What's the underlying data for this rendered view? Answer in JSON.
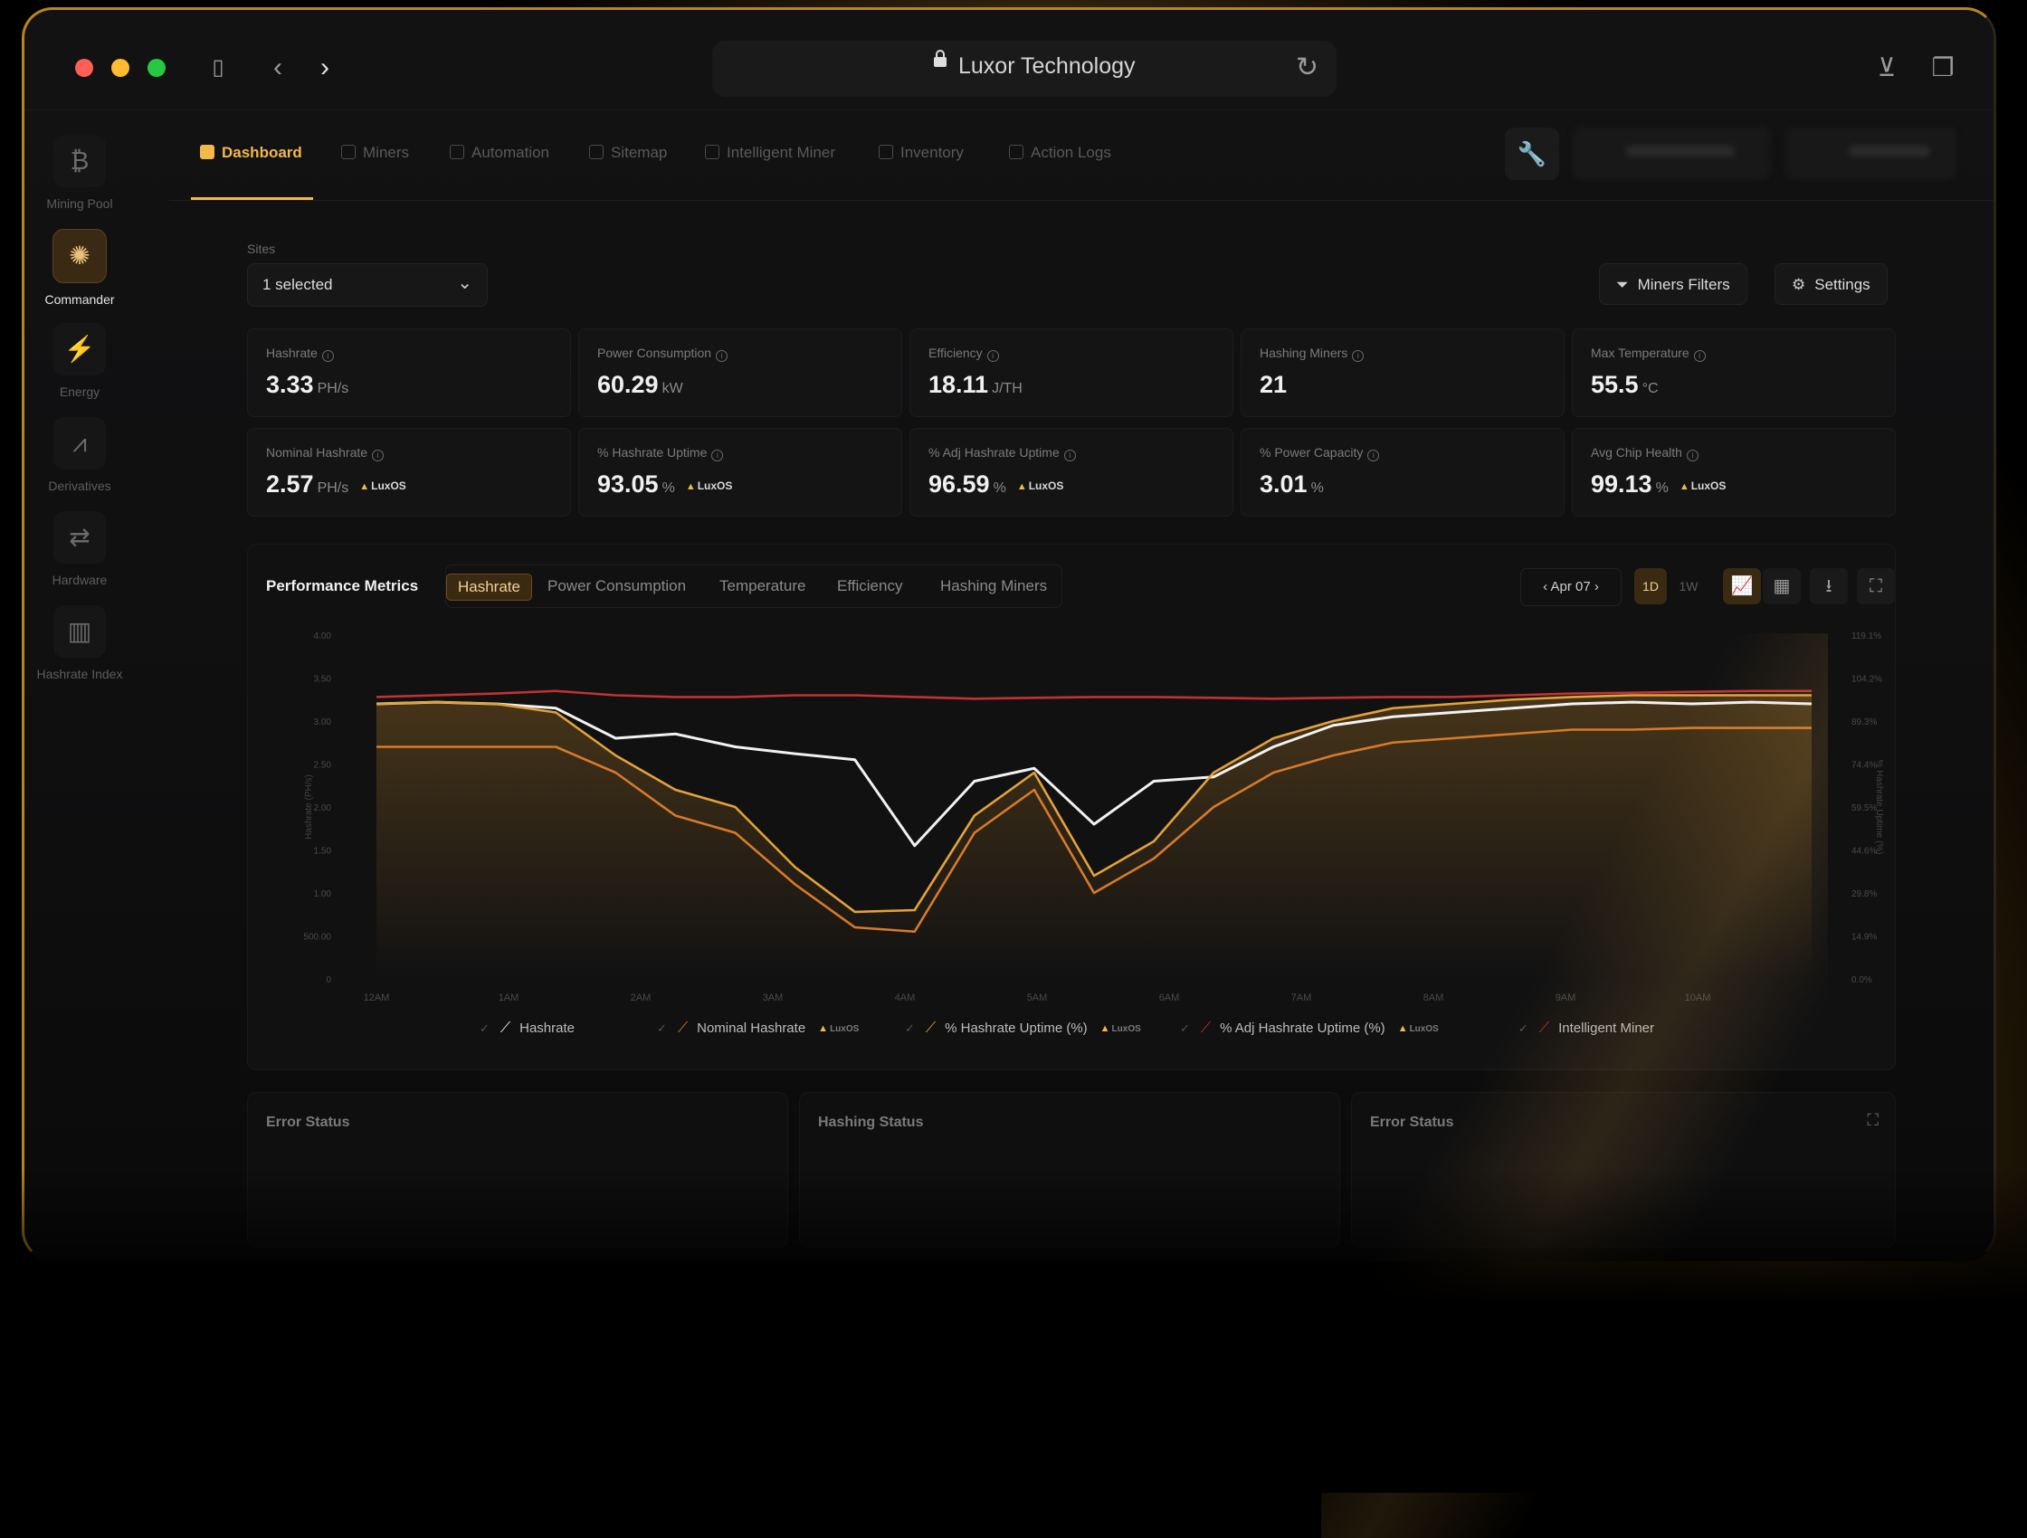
{
  "browser": {
    "title": "Luxor Technology"
  },
  "sidebar": {
    "items": [
      {
        "label": "Mining Pool",
        "icon": "bitcoin-icon",
        "active": false
      },
      {
        "label": "Commander",
        "icon": "commander-icon",
        "active": true
      },
      {
        "label": "Energy",
        "icon": "bolt-icon",
        "active": false
      },
      {
        "label": "Derivatives",
        "icon": "derivatives-icon",
        "active": false
      },
      {
        "label": "Hardware",
        "icon": "swap-icon",
        "active": false
      },
      {
        "label": "Hashrate Index",
        "icon": "bar-chart-icon",
        "active": false
      }
    ]
  },
  "nav": {
    "tabs": [
      {
        "label": "Dashboard",
        "active": true
      },
      {
        "label": "Miners"
      },
      {
        "label": "Automation"
      },
      {
        "label": "Sitemap"
      },
      {
        "label": "Intelligent Miner"
      },
      {
        "label": "Inventory"
      },
      {
        "label": "Action Logs"
      }
    ]
  },
  "sites": {
    "label": "Sites",
    "value": "1 selected"
  },
  "toolbar": {
    "filters": "Miners Filters",
    "settings": "Settings"
  },
  "cards": [
    {
      "label": "Hashrate",
      "value": "3.33",
      "unit": "PH/s",
      "luxos": false
    },
    {
      "label": "Power Consumption",
      "value": "60.29",
      "unit": "kW",
      "luxos": false
    },
    {
      "label": "Efficiency",
      "value": "18.11",
      "unit": "J/TH",
      "luxos": false
    },
    {
      "label": "Hashing Miners",
      "value": "21",
      "unit": "",
      "luxos": false
    },
    {
      "label": "Max Temperature",
      "value": "55.5",
      "unit": "°C",
      "luxos": false
    },
    {
      "label": "Nominal Hashrate",
      "value": "2.57",
      "unit": "PH/s",
      "luxos": true
    },
    {
      "label": "% Hashrate Uptime",
      "value": "93.05",
      "unit": "%",
      "luxos": true
    },
    {
      "label": "% Adj Hashrate Uptime",
      "value": "96.59",
      "unit": "%",
      "luxos": true
    },
    {
      "label": "% Power Capacity",
      "value": "3.01",
      "unit": "%",
      "luxos": false
    },
    {
      "label": "Avg Chip Health",
      "value": "99.13",
      "unit": "%",
      "luxos": true
    }
  ],
  "luxos_label": "LuxOS",
  "performance": {
    "title": "Performance Metrics",
    "tabs": [
      "Hashrate",
      "Power Consumption",
      "Temperature",
      "Efficiency",
      "Hashing Miners"
    ],
    "active_tab": "Hashrate",
    "date": "Apr 07",
    "ranges": [
      "1D",
      "1W"
    ],
    "active_range": "1D"
  },
  "chart_data": {
    "type": "line",
    "x": [
      "12AM",
      "1AM",
      "2AM",
      "3AM",
      "4AM",
      "5AM",
      "6AM",
      "7AM",
      "8AM",
      "9AM",
      "10AM"
    ],
    "y_left_ticks": [
      "0",
      "500.00",
      "1.00",
      "1.50",
      "2.00",
      "2.50",
      "3.00",
      "3.50",
      "4.00"
    ],
    "y_right_ticks": [
      "0.0%",
      "14.9%",
      "29.8%",
      "44.6%",
      "59.5%",
      "74.4%",
      "89.3%",
      "104.2%",
      "119.1%"
    ],
    "y_left_label": "Hashrate (PH/s)",
    "y_right_label": "% Hashrate Uptime (%)",
    "series": [
      {
        "name": "Hashrate",
        "color": "#f2f2f2",
        "values": [
          3.2,
          3.22,
          3.2,
          3.15,
          2.8,
          2.85,
          2.7,
          2.62,
          2.55,
          1.55,
          2.3,
          2.45,
          1.8,
          2.3,
          2.35,
          2.7,
          2.95,
          3.05,
          3.1,
          3.15,
          3.2,
          3.22,
          3.2,
          3.22,
          3.2
        ]
      },
      {
        "name": "Nominal Hashrate",
        "color": "#d87a2a",
        "values": [
          2.7,
          2.7,
          2.7,
          2.7,
          2.4,
          1.9,
          1.7,
          1.1,
          0.6,
          0.55,
          1.7,
          2.2,
          1.0,
          1.4,
          2.0,
          2.4,
          2.6,
          2.75,
          2.8,
          2.85,
          2.9,
          2.9,
          2.92,
          2.92,
          2.92
        ]
      },
      {
        "name": "% Hashrate Uptime (%)",
        "color": "#e4a23a",
        "values": [
          3.2,
          3.22,
          3.2,
          3.1,
          2.6,
          2.2,
          2.0,
          1.3,
          0.78,
          0.8,
          1.9,
          2.4,
          1.2,
          1.6,
          2.4,
          2.8,
          3.0,
          3.15,
          3.2,
          3.25,
          3.28,
          3.3,
          3.3,
          3.3,
          3.3
        ]
      },
      {
        "name": "% Adj Hashrate Uptime (%)",
        "color": "#c23232",
        "values": [
          3.28,
          3.3,
          3.32,
          3.35,
          3.3,
          3.28,
          3.28,
          3.3,
          3.3,
          3.28,
          3.26,
          3.27,
          3.28,
          3.28,
          3.27,
          3.26,
          3.27,
          3.28,
          3.28,
          3.3,
          3.32,
          3.33,
          3.34,
          3.35,
          3.35
        ]
      },
      {
        "name": "Intelligent Miner",
        "color": "#b8322c",
        "values": []
      }
    ],
    "ylim": [
      0,
      4
    ],
    "grid": false,
    "legend": "bottom"
  },
  "legend_luxos": [
    false,
    true,
    true,
    true,
    false
  ],
  "bottom": {
    "error_status": "Error Status",
    "hashing_status": "Hashing Status",
    "error_status_2": "Error Status"
  }
}
